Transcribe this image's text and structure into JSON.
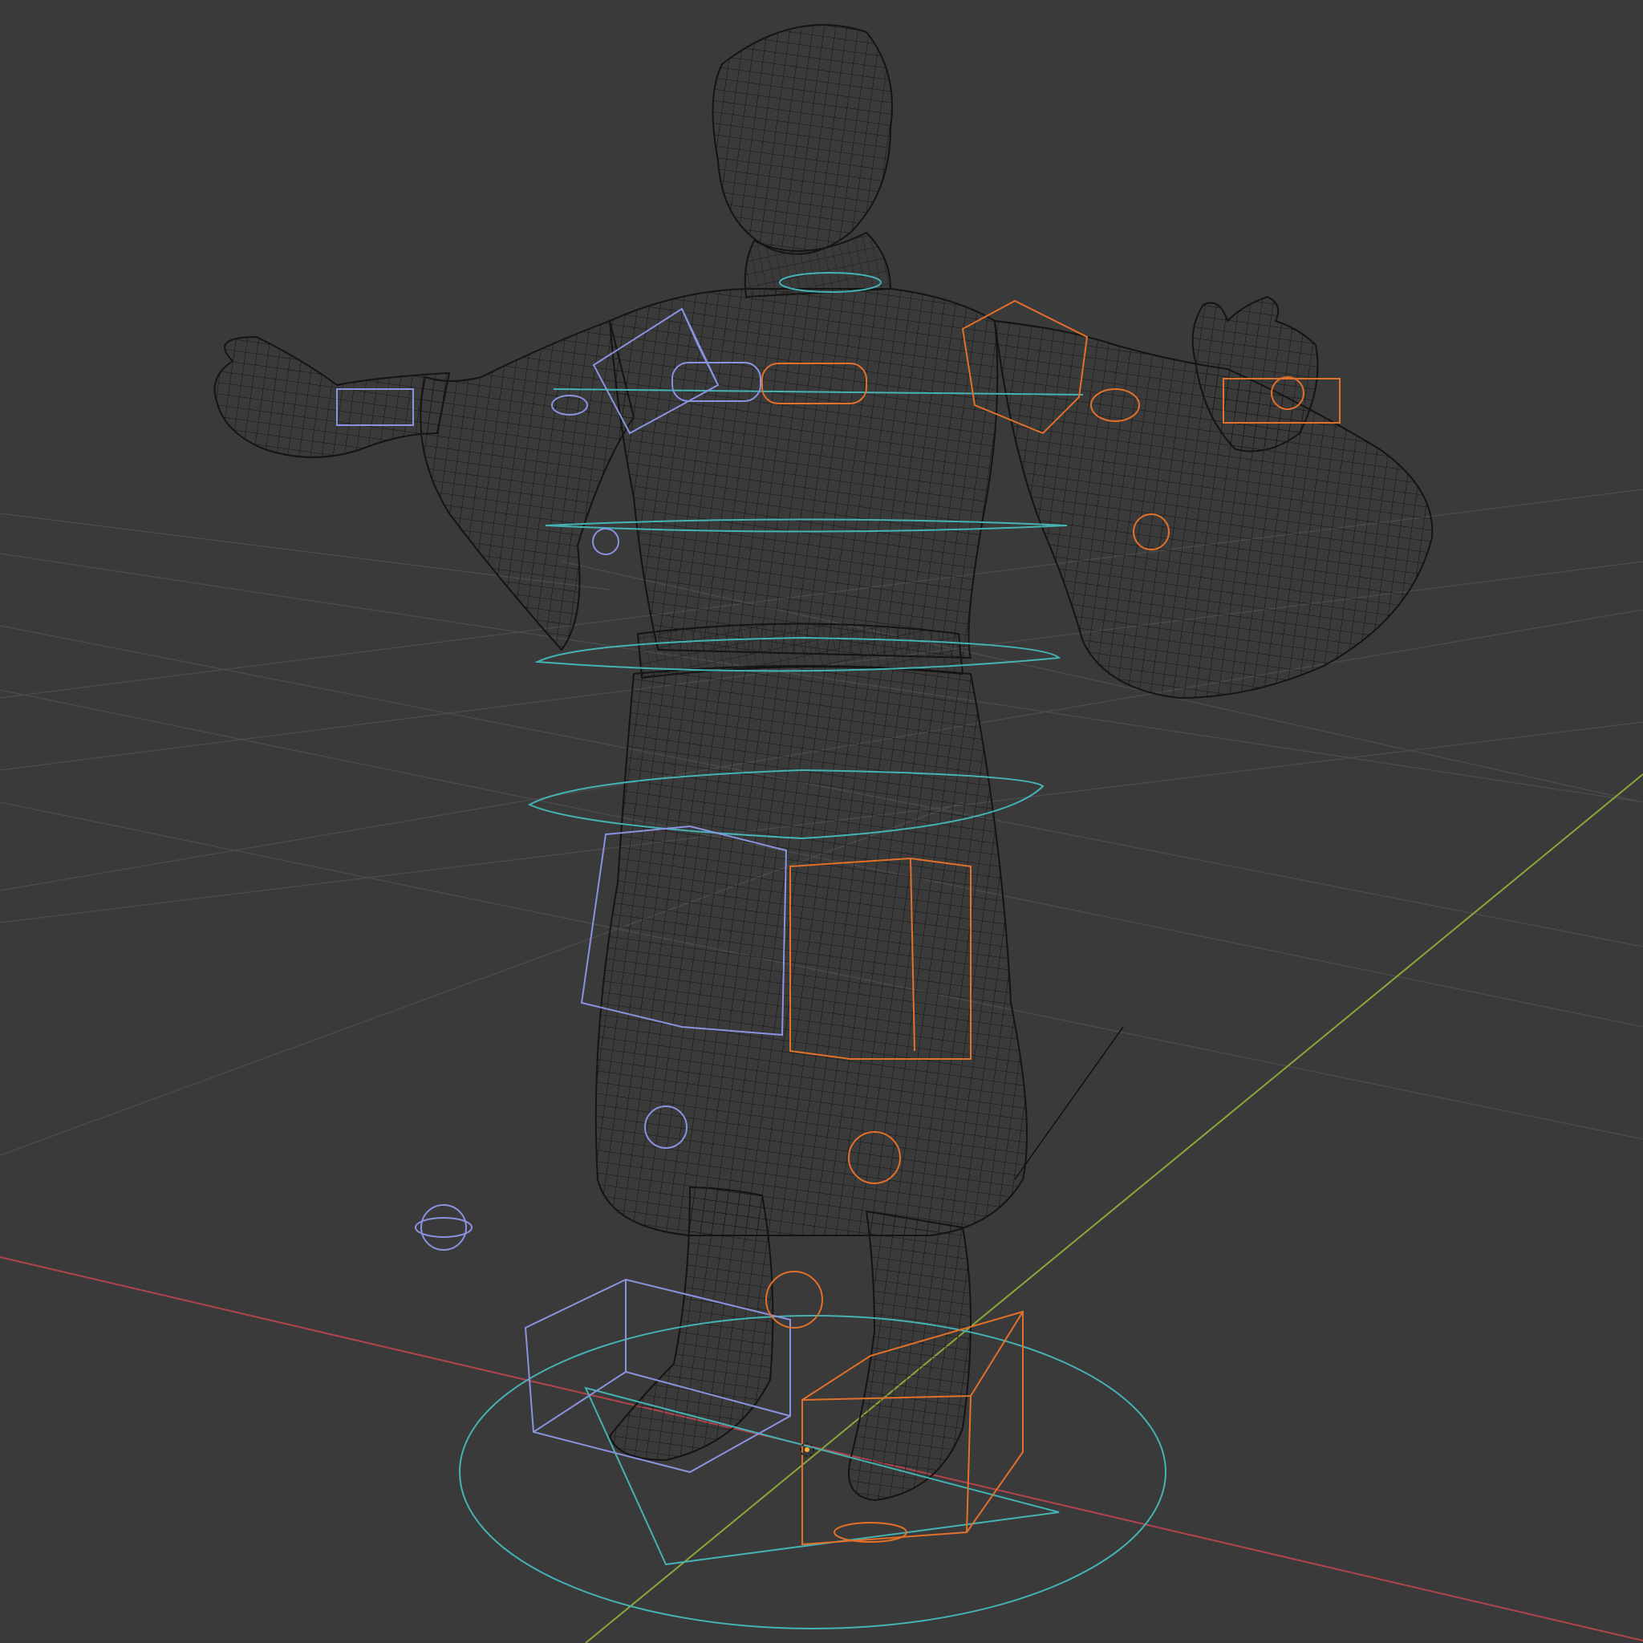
{
  "viewport": {
    "background": "#3a3a3a",
    "grid_color": "#4a4a4a",
    "x_axis_color": "#b0444c",
    "y_axis_color": "#8aa83a",
    "mesh_color": "#141414",
    "left_controls_color": "#8a93e0",
    "right_controls_color": "#e0702a",
    "center_controls_color": "#45b3b3",
    "origin_color": "#ffb030",
    "shading": "wireframe"
  }
}
